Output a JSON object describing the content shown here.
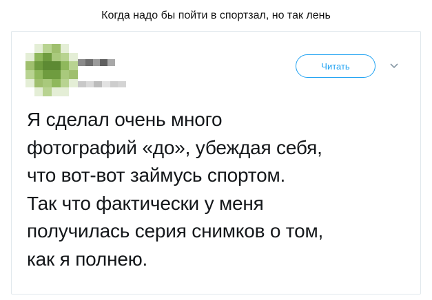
{
  "caption": "Когда надо бы пойти в спортзал, но так лень",
  "tweet": {
    "follow_label": "Читать",
    "caret_icon": "chevron-down-icon",
    "avatar_icon": "pixelated-avatar",
    "text_lines": [
      "Я сделал очень много",
      "фотографий «до», убеждая себя,",
      "что вот-вот займусь спортом.",
      "Так что фактически у меня",
      "получилась серия снимков о том,",
      "как я полнею."
    ]
  },
  "colors": {
    "accent": "#1da1f2",
    "text": "#14171a",
    "border": "#e1e8ed"
  }
}
